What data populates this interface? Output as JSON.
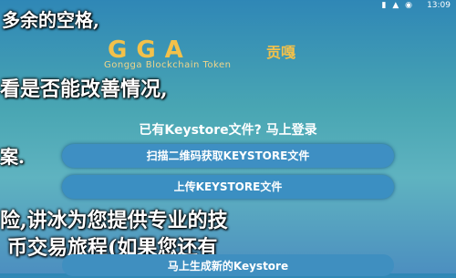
{
  "status": {
    "time": "13:09",
    "icons": "▮ ▲ ◉"
  },
  "overlay": {
    "line1": "多余的空格,",
    "line2": "看是否能改善情况,",
    "line3": "案.",
    "line4": "险,讲冰为您提供专业的技",
    "line5": "币交易旅程(如果您还有",
    "line5b": ")"
  },
  "logo": {
    "letters": "GGA",
    "cn": "贡嘎",
    "subtitle": "Gongga Blockchain Token"
  },
  "login_link": "已有Keystore文件? 马上登录",
  "buttons": {
    "scan": "扫描二维码获取KEYSTORE文件",
    "upload": "上传KEYSTORE文件",
    "generate": "马上生成新的Keystore"
  }
}
